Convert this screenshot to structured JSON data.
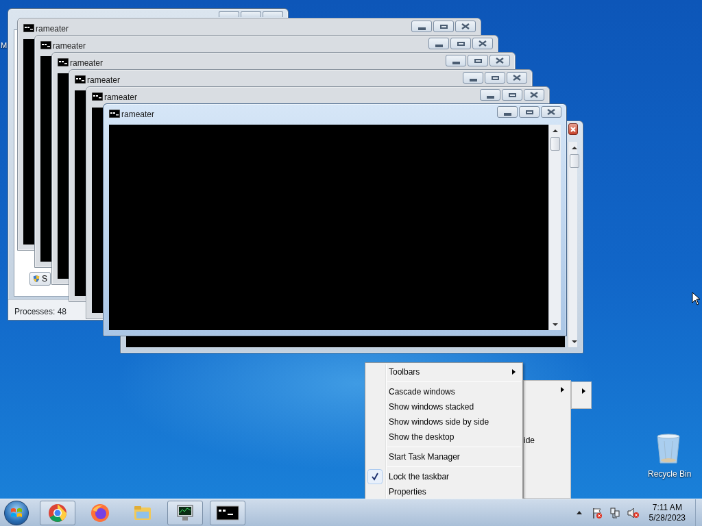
{
  "desktop": {
    "icons": [
      {
        "kind": "partial",
        "label": "M"
      },
      {
        "kind": "recycle-bin",
        "label": "Recycle Bin"
      }
    ]
  },
  "task_manager": {
    "button": "S",
    "status": "Processes: 48"
  },
  "console_windows": [
    {
      "title": "rameater",
      "active": false
    },
    {
      "title": "rameater",
      "active": false
    },
    {
      "title": "rameater",
      "active": false
    },
    {
      "title": "rameater",
      "active": false
    },
    {
      "title": "rameater",
      "active": false
    },
    {
      "title": "rameater",
      "active": true
    }
  ],
  "context_menu": {
    "items": [
      {
        "kind": "item",
        "label": "Toolbars",
        "submenu": true,
        "checked": false
      },
      {
        "kind": "separator"
      },
      {
        "kind": "item",
        "label": "Cascade windows",
        "submenu": false,
        "checked": false
      },
      {
        "kind": "item",
        "label": "Show windows stacked",
        "submenu": false,
        "checked": false
      },
      {
        "kind": "item",
        "label": "Show windows side by side",
        "submenu": false,
        "checked": false
      },
      {
        "kind": "item",
        "label": "Show the desktop",
        "submenu": false,
        "checked": false
      },
      {
        "kind": "separator"
      },
      {
        "kind": "item",
        "label": "Start Task Manager",
        "submenu": false,
        "checked": false
      },
      {
        "kind": "separator"
      },
      {
        "kind": "item",
        "label": "Lock the taskbar",
        "submenu": false,
        "checked": true
      },
      {
        "kind": "item",
        "label": "Properties",
        "submenu": false,
        "checked": false
      }
    ]
  },
  "ghost_menu": {
    "text": "ide"
  },
  "taskbar": {
    "apps": [
      {
        "kind": "chrome",
        "running": true
      },
      {
        "kind": "firefox",
        "running": false
      },
      {
        "kind": "explorer",
        "running": false
      },
      {
        "kind": "task-manager",
        "running": true
      },
      {
        "kind": "console",
        "running": true
      }
    ],
    "clock": {
      "time": "7:11 AM",
      "date": "5/28/2023"
    }
  }
}
